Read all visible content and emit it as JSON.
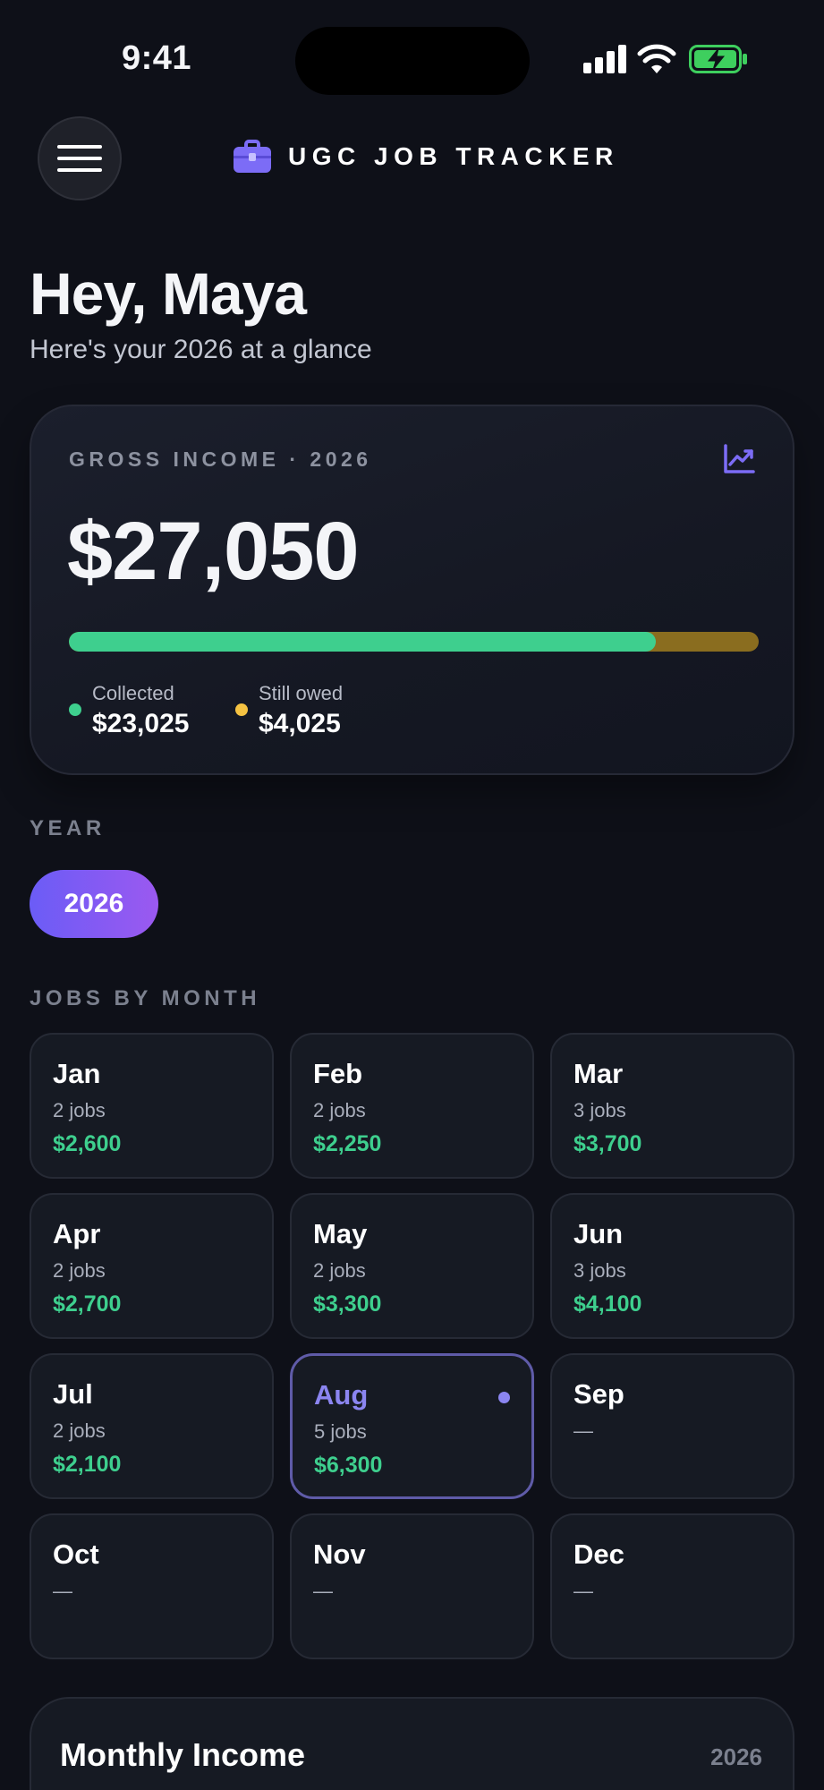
{
  "status_bar": {
    "time": "9:41"
  },
  "header": {
    "app_title": "UGC JOB TRACKER",
    "menu_icon": "hamburger-icon",
    "brand_icon": "briefcase-icon"
  },
  "greeting": {
    "title": "Hey, Maya",
    "subtitle": "Here's your 2026 at a glance"
  },
  "income": {
    "label": "GROSS INCOME · 2026",
    "total": "$27,050",
    "collected_fraction": 0.851,
    "collected_label": "Collected",
    "collected_value": "$23,025",
    "owed_label": "Still owed",
    "owed_value": "$4,025",
    "chart_icon": "trending-up-icon"
  },
  "year_section": {
    "label": "YEAR",
    "selected": "2026"
  },
  "months_section": {
    "label": "JOBS BY MONTH",
    "months": [
      {
        "name": "Jan",
        "jobs": "2 jobs",
        "amount": "$2,600"
      },
      {
        "name": "Feb",
        "jobs": "2 jobs",
        "amount": "$2,250"
      },
      {
        "name": "Mar",
        "jobs": "3 jobs",
        "amount": "$3,700"
      },
      {
        "name": "Apr",
        "jobs": "2 jobs",
        "amount": "$2,700"
      },
      {
        "name": "May",
        "jobs": "2 jobs",
        "amount": "$3,300"
      },
      {
        "name": "Jun",
        "jobs": "3 jobs",
        "amount": "$4,100"
      },
      {
        "name": "Jul",
        "jobs": "2 jobs",
        "amount": "$2,100"
      },
      {
        "name": "Aug",
        "jobs": "5 jobs",
        "amount": "$6,300",
        "current": true
      },
      {
        "name": "Sep",
        "jobs": "—",
        "amount": ""
      },
      {
        "name": "Oct",
        "jobs": "—",
        "amount": ""
      },
      {
        "name": "Nov",
        "jobs": "—",
        "amount": ""
      },
      {
        "name": "Dec",
        "jobs": "—",
        "amount": ""
      }
    ]
  },
  "monthly_income": {
    "title": "Monthly Income",
    "year": "2026"
  },
  "colors": {
    "accent": "#6b5cf6",
    "collected": "#3ecf8e",
    "owed": "#f5c242",
    "background": "#0e1018"
  }
}
